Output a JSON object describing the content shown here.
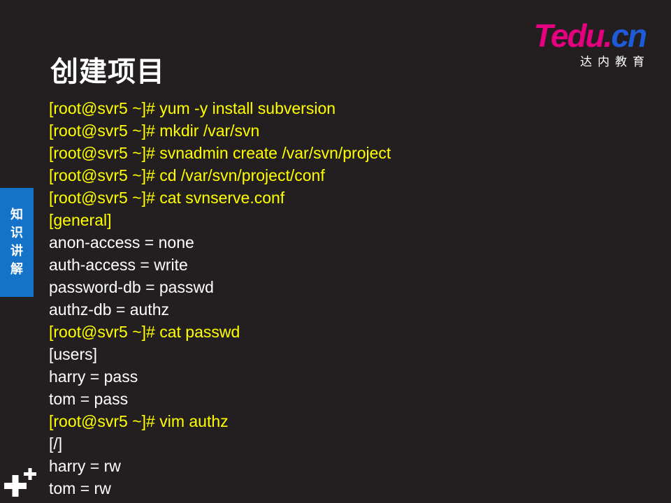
{
  "title": "创建项目",
  "logo": {
    "brand": "Tedu",
    "dot": ".",
    "tld": "cn",
    "subtitle": "达内教育"
  },
  "side_tab": [
    "知",
    "识",
    "讲",
    "解"
  ],
  "colors": {
    "background": "#231f20",
    "command_text": "#ffff00",
    "output_text": "#ffffff",
    "side_tab": "#1572c9",
    "logo_pink": "#e4007f",
    "logo_blue": "#1e5bd8"
  },
  "lines": [
    {
      "text": "[root@svr5 ~]# yum -y install subversion",
      "kind": "cmd"
    },
    {
      "text": "[root@svr5 ~]# mkdir /var/svn",
      "kind": "cmd"
    },
    {
      "text": "[root@svr5 ~]# svnadmin create /var/svn/project",
      "kind": "cmd"
    },
    {
      "text": "[root@svr5 ~]# cd /var/svn/project/conf",
      "kind": "cmd"
    },
    {
      "text": "[root@svr5 ~]# cat svnserve.conf",
      "kind": "cmd"
    },
    {
      "text": "[general]",
      "kind": "cmd"
    },
    {
      "text": "anon-access = none",
      "kind": "out"
    },
    {
      "text": "auth-access = write",
      "kind": "out"
    },
    {
      "text": "password-db = passwd",
      "kind": "out"
    },
    {
      "text": "authz-db = authz",
      "kind": "out"
    },
    {
      "text": "[root@svr5 ~]# cat passwd",
      "kind": "cmd"
    },
    {
      "text": "[users]",
      "kind": "out"
    },
    {
      "text": "harry = pass",
      "kind": "out"
    },
    {
      "text": "tom = pass",
      "kind": "out"
    },
    {
      "text": "[root@svr5 ~]# vim authz",
      "kind": "cmd"
    },
    {
      "text": "[/]",
      "kind": "out"
    },
    {
      "text": "harry = rw",
      "kind": "out"
    },
    {
      "text": "tom = rw",
      "kind": "out"
    }
  ],
  "icons": {
    "corner": "plus-plus-icon"
  }
}
